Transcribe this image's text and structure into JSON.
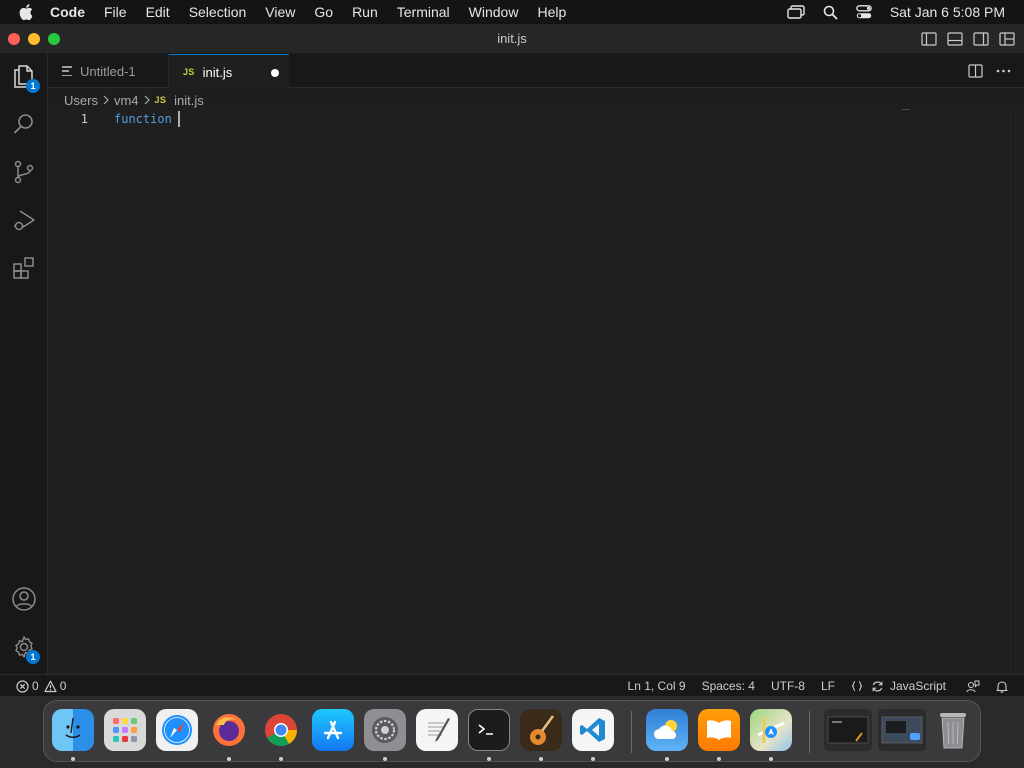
{
  "menubar": {
    "app_name": "Code",
    "menus": [
      "File",
      "Edit",
      "Selection",
      "View",
      "Go",
      "Run",
      "Terminal",
      "Window",
      "Help"
    ],
    "clock": "Sat Jan 6  5:08 PM"
  },
  "window": {
    "title": "init.js"
  },
  "activity_bar": {
    "explorer_badge": "1",
    "settings_badge": "1",
    "accent": "#0078d4"
  },
  "tabs": [
    {
      "label": "Untitled-1",
      "active": false,
      "icon": "lines-icon"
    },
    {
      "label": "init.js",
      "active": true,
      "icon": "js-file-icon",
      "icon_text": "JS",
      "dirty": true
    }
  ],
  "breadcrumb": {
    "items": [
      "Users",
      "vm4"
    ],
    "file_icon_text": "JS",
    "file": "init.js"
  },
  "editor": {
    "line_number": "1",
    "code": "function ",
    "keyword_color": "#569cd6"
  },
  "statusbar": {
    "errors": "0",
    "warnings": "0",
    "position": "Ln 1, Col 9",
    "indent": "Spaces: 4",
    "encoding": "UTF-8",
    "eol": "LF",
    "language": "JavaScript"
  },
  "dock": {
    "apps": [
      "Finder",
      "Launchpad",
      "Safari",
      "Firefox",
      "Chrome",
      "App Store",
      "System Settings",
      "TextEdit",
      "Terminal",
      "GarageBand",
      "Visual Studio Code",
      "Weather",
      "Books",
      "Maps",
      "Window Preview",
      "Screen Capture",
      "Trash"
    ]
  }
}
